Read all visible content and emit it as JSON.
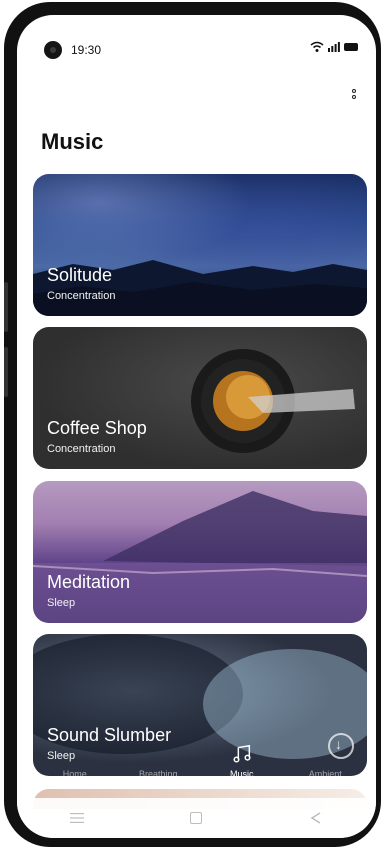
{
  "status": {
    "time": "19:30",
    "icons": [
      "wifi-icon",
      "signal-icon",
      "battery-icon"
    ]
  },
  "header": {
    "title": "Music",
    "menu_icon": "more-vertical-icon"
  },
  "cards": [
    {
      "title": "Solitude",
      "subtitle": "Concentration"
    },
    {
      "title": "Coffee Shop",
      "subtitle": "Concentration"
    },
    {
      "title": "Meditation",
      "subtitle": "Sleep"
    },
    {
      "title": "Sound Slumber",
      "subtitle": "Sleep"
    }
  ],
  "tabs": [
    {
      "label": "Home",
      "icon": "home-icon"
    },
    {
      "label": "Breathing",
      "icon": "breathing-icon"
    },
    {
      "label": "Music",
      "icon": "music-note-icon",
      "active": true
    },
    {
      "label": "Ambient",
      "icon": "ambient-icon"
    }
  ],
  "fab": {
    "icon": "download-icon"
  },
  "navbar": {
    "icons": [
      "menu-icon",
      "home-square-icon",
      "back-triangle-icon"
    ]
  },
  "colors": {
    "accent": "#111111",
    "card_text": "#ffffff"
  }
}
